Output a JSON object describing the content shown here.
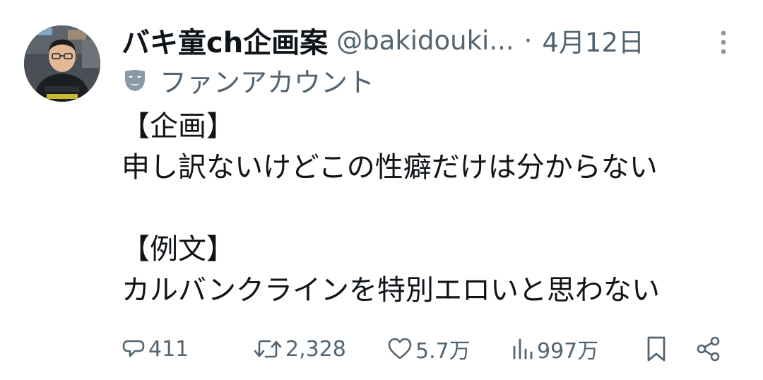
{
  "tweet": {
    "display_name": "バキ童ch企画案",
    "handle": "@bakidouki...",
    "separator": "·",
    "date": "4月12日",
    "account_label": "ファンアカウント",
    "body_lines": [
      "【企画】",
      "申し訳ないけどこの性癖だけは分からない",
      "",
      "【例文】",
      "カルバンクラインを特別エロいと思わない"
    ]
  },
  "actions": {
    "reply_count": "411",
    "retweet_count": "2,328",
    "like_count": "5.7万",
    "view_count": "997万"
  },
  "icons": {
    "more": "more-vertical-icon",
    "account_type": "theater-mask-icon",
    "reply": "reply-icon",
    "retweet": "retweet-icon",
    "like": "heart-icon",
    "views": "views-chart-icon",
    "bookmark": "bookmark-icon",
    "share": "share-icon"
  },
  "colors": {
    "text_primary": "#0f1419",
    "text_secondary": "#536471",
    "background": "#ffffff"
  }
}
